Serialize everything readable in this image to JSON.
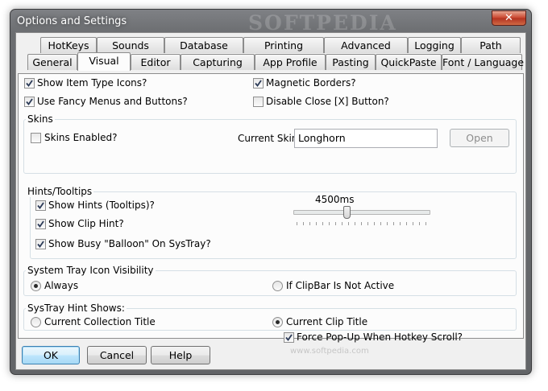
{
  "window": {
    "title": "Options and Settings",
    "watermark": "SOFTPEDIA",
    "close_symbol": "✕"
  },
  "tabs": {
    "row1": [
      "HotKeys",
      "Sounds",
      "Database",
      "Printing",
      "Advanced",
      "Logging",
      "Path"
    ],
    "row2": [
      "General",
      "Visual",
      "Editor",
      "Capturing",
      "App Profile",
      "Pasting",
      "QuickPaste",
      "Font / Language"
    ],
    "active": "Visual"
  },
  "visual": {
    "show_item_type_icons": {
      "label": "Show Item Type Icons?",
      "checked": true
    },
    "use_fancy_menus": {
      "label": "Use Fancy Menus and Buttons?",
      "checked": true
    },
    "magnetic_borders": {
      "label": "Magnetic Borders?",
      "checked": true
    },
    "disable_close_button": {
      "label": "Disable Close [X] Button?",
      "checked": false
    }
  },
  "skins": {
    "group_title": "Skins",
    "skins_enabled": {
      "label": "Skins Enabled?",
      "checked": false
    },
    "current_skin_label": "Current Skin:",
    "current_skin_value": "Longhorn",
    "open_button": "Open"
  },
  "hints": {
    "group_title": "Hints/Tooltips",
    "show_hints": {
      "label": "Show Hints (Tooltips)?",
      "checked": true
    },
    "show_clip_hint": {
      "label": "Show Clip Hint?",
      "checked": true
    },
    "show_busy_balloon": {
      "label": "Show Busy \"Balloon\" On SysTray?",
      "checked": true
    },
    "slider_value_text": "4500ms"
  },
  "tray_icon": {
    "group_title": "System Tray Icon Visibility",
    "options": [
      "Always",
      "If ClipBar Is Not Active"
    ],
    "selected": "Always"
  },
  "systray_hint": {
    "group_title": "SysTray Hint Shows:",
    "options": [
      "Current Collection Title",
      "Current Clip Title"
    ],
    "selected": "Current Clip Title",
    "force_popup": {
      "label": "Force Pop-Up When Hotkey Scroll?",
      "checked": true
    }
  },
  "footer": {
    "ok": "OK",
    "cancel": "Cancel",
    "help": "Help",
    "watermark_url": "www.softpedia.com"
  }
}
